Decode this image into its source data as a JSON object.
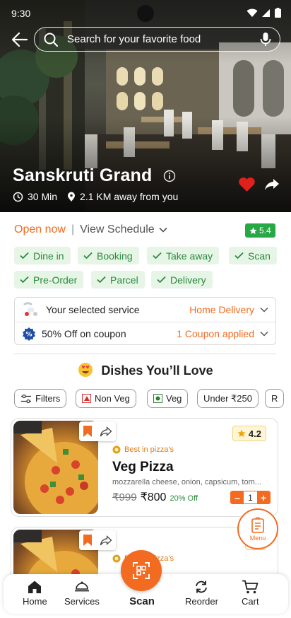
{
  "status": {
    "time": "9:30"
  },
  "search": {
    "placeholder": "Search for your favorite food"
  },
  "restaurant": {
    "name": "Sanskruti Grand",
    "time": "30 Min",
    "distance": "2.1 KM away from you",
    "open_status": "Open now",
    "schedule_label": "View Schedule",
    "rating": "5.4"
  },
  "services": [
    "Dine in",
    "Booking",
    "Take away",
    "Scan",
    "Pre-Order",
    "Parcel",
    "Delivery"
  ],
  "service_box": {
    "service_label": "Your selected service",
    "service_value": "Home Delivery",
    "coupon_label": "50% Off on coupon",
    "coupon_value": "1 Coupon applied"
  },
  "dishes_title": "Dishes You’ll Love",
  "filters": [
    "Filters",
    "Non Veg",
    "Veg",
    "Under ₹250",
    "R"
  ],
  "dishes": [
    {
      "badge": "Best in pizza's",
      "name": "Veg Pizza",
      "description": "mozzarella cheese, onion, capsicum, tom...",
      "old_price": "₹999",
      "new_price": "₹800",
      "discount": "20% Off",
      "rating": "4.2",
      "quantity": "1"
    },
    {
      "badge": "Best in pizza's"
    }
  ],
  "menu_fab_label": "Menu",
  "nav": {
    "home": "Home",
    "services": "Services",
    "scan": "Scan",
    "reorder": "Reorder",
    "cart": "Cart"
  },
  "colors": {
    "accent": "#f26b21",
    "green": "#2b8a3e",
    "chip_bg": "#e6f5e6",
    "heart": "#e0201b"
  }
}
